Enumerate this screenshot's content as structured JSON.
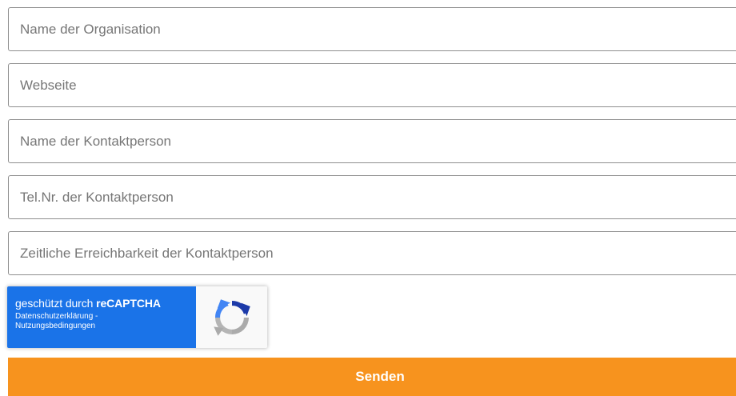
{
  "form": {
    "fields": [
      {
        "placeholder": "Name der Organisation",
        "value": ""
      },
      {
        "placeholder": "Webseite",
        "value": ""
      },
      {
        "placeholder": "Name der Kontaktperson",
        "value": ""
      },
      {
        "placeholder": "Tel.Nr. der Kontaktperson",
        "value": ""
      },
      {
        "placeholder": "Zeitliche Erreichbarkeit der Kontaktperson",
        "value": ""
      }
    ],
    "submit_label": "Senden"
  },
  "recaptcha": {
    "title_prefix": "geschützt durch ",
    "title_brand": "reCAPTCHA",
    "privacy_link": "Datenschutzerklärung",
    "separator": " - ",
    "terms_link": "Nutzungsbedingungen",
    "icon": "recaptcha-logo-icon"
  },
  "colors": {
    "accent": "#f7931e",
    "recaptcha_blue": "#1a73e8",
    "field_border": "#8f8f8f"
  }
}
